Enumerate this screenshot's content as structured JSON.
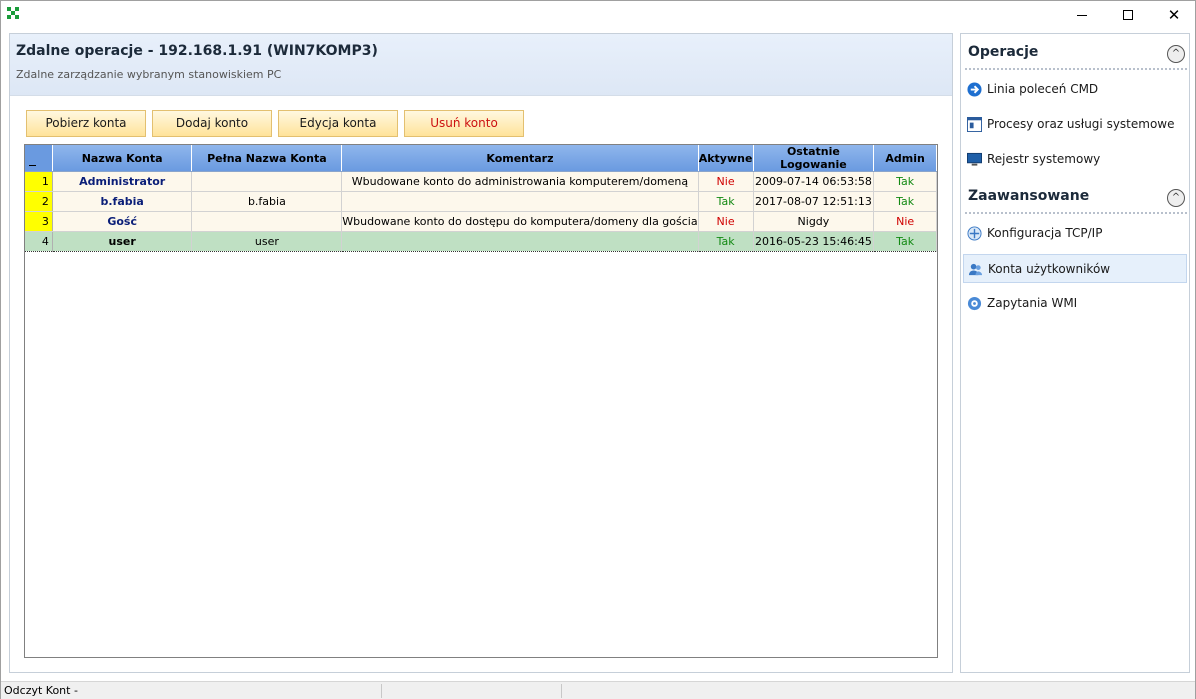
{
  "window": {
    "minimize": "—",
    "maximize": "☐",
    "close": "✕"
  },
  "header": {
    "title": "Zdalne operacje - 192.168.1.91 (WIN7KOMP3)",
    "subtitle": "Zdalne zarządzanie wybranym stanowiskiem PC"
  },
  "toolbar": {
    "get_label": "Pobierz konta",
    "add_label": "Dodaj konto",
    "edit_label": "Edycja konta",
    "delete_label": "Usuń konto"
  },
  "table": {
    "columns": [
      "Nazwa Konta",
      "Pełna Nazwa Konta",
      "Komentarz",
      "Aktywne",
      "Ostatnie Logowanie",
      "Admin"
    ],
    "rows": [
      {
        "num": "1",
        "name": "Administrator",
        "full_name": "",
        "comment": "Wbudowane konto do administrowania komputerem/domeną",
        "active": "Nie",
        "last_login": "2009-07-14 06:53:58",
        "admin": "Tak"
      },
      {
        "num": "2",
        "name": "b.fabia",
        "full_name": "b.fabia",
        "comment": "",
        "active": "Tak",
        "last_login": "2017-08-07 12:51:13",
        "admin": "Tak"
      },
      {
        "num": "3",
        "name": "Gość",
        "full_name": "",
        "comment": "Wbudowane konto do dostępu do komputera/domeny dla gościa",
        "active": "Nie",
        "last_login": "Nigdy",
        "admin": "Nie"
      },
      {
        "num": "4",
        "name": "user",
        "full_name": "user",
        "comment": "",
        "active": "Tak",
        "last_login": "2016-05-23 15:46:45",
        "admin": "Tak"
      }
    ]
  },
  "sidebar": {
    "operations_title": "Operacje",
    "advanced_title": "Zaawansowane",
    "collapse_glyph": "^",
    "operations_items": [
      {
        "label": "Linia poleceń CMD",
        "icon": "arrow-right-icon"
      },
      {
        "label": "Procesy oraz usługi systemowe",
        "icon": "window-icon"
      },
      {
        "label": "Rejestr systemowy",
        "icon": "monitor-icon"
      }
    ],
    "advanced_items": [
      {
        "label": "Konfiguracja TCP/IP",
        "icon": "network-icon"
      },
      {
        "label": "Konta użytkowników",
        "icon": "users-icon"
      },
      {
        "label": "Zapytania WMI",
        "icon": "wmi-icon"
      }
    ]
  },
  "status": {
    "text": "Odczyt Kont -"
  },
  "colors": {
    "header_blue": "#6a9ae0",
    "row_number_yellow": "#ffff00",
    "no_red": "#d00000",
    "yes_green": "#148a14",
    "selected_row": "#bfe0c3"
  }
}
